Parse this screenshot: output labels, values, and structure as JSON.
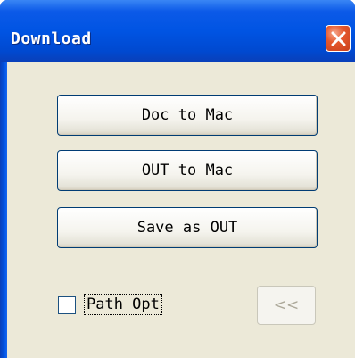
{
  "window": {
    "title": "Download",
    "close_icon": "close-x-icon"
  },
  "buttons": {
    "doc_to_mac": "Doc to Mac",
    "out_to_mac": "OUT to Mac",
    "save_as_out": "Save as OUT"
  },
  "path_opt": {
    "label": "Path Opt",
    "checked": false
  },
  "collapse_button": {
    "label": "<<",
    "enabled": false
  },
  "colors": {
    "titlebar": "#0054e3",
    "client_background": "#ece9d8",
    "close_button": "#e5582d",
    "button_border": "#003c74",
    "disabled_text": "#aca899"
  }
}
